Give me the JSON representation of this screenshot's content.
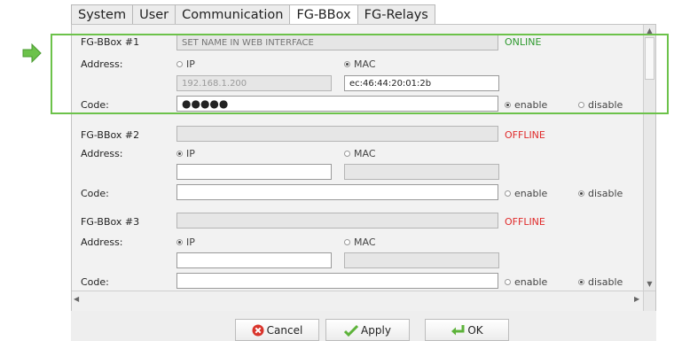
{
  "tabs": [
    {
      "label": "System"
    },
    {
      "label": "User"
    },
    {
      "label": "Communication"
    },
    {
      "label": "FG-BBox"
    },
    {
      "label": "FG-Relays"
    }
  ],
  "labels": {
    "address": "Address:",
    "code": "Code:",
    "ip": "IP",
    "mac": "MAC",
    "enable": "enable",
    "disable": "disable"
  },
  "boxes": [
    {
      "title": "FG-BBox #1",
      "name_placeholder": "SET NAME IN WEB INTERFACE",
      "status": "ONLINE",
      "address_mode": "MAC",
      "ip_value": "192.168.1.200",
      "mac_value": "ec:46:44:20:01:2b",
      "code_value": "●●●●●",
      "code_mode": "enable"
    },
    {
      "title": "FG-BBox #2",
      "name_placeholder": "",
      "status": "OFFLINE",
      "address_mode": "IP",
      "ip_value": "",
      "mac_value": "",
      "code_value": "",
      "code_mode": "disable"
    },
    {
      "title": "FG-BBox #3",
      "name_placeholder": "",
      "status": "OFFLINE",
      "address_mode": "IP",
      "ip_value": "",
      "mac_value": "",
      "code_value": "",
      "code_mode": "disable"
    }
  ],
  "buttons": {
    "cancel": "Cancel",
    "apply": "Apply",
    "ok": "OK"
  },
  "colors": {
    "online": "#2f9a2f",
    "offline": "#e02b2b",
    "highlight": "#6cc24a"
  },
  "icons": {
    "pointer": "green-arrow-icon",
    "cancel": "red-x-icon",
    "apply": "green-check-icon",
    "ok": "green-return-icon"
  }
}
